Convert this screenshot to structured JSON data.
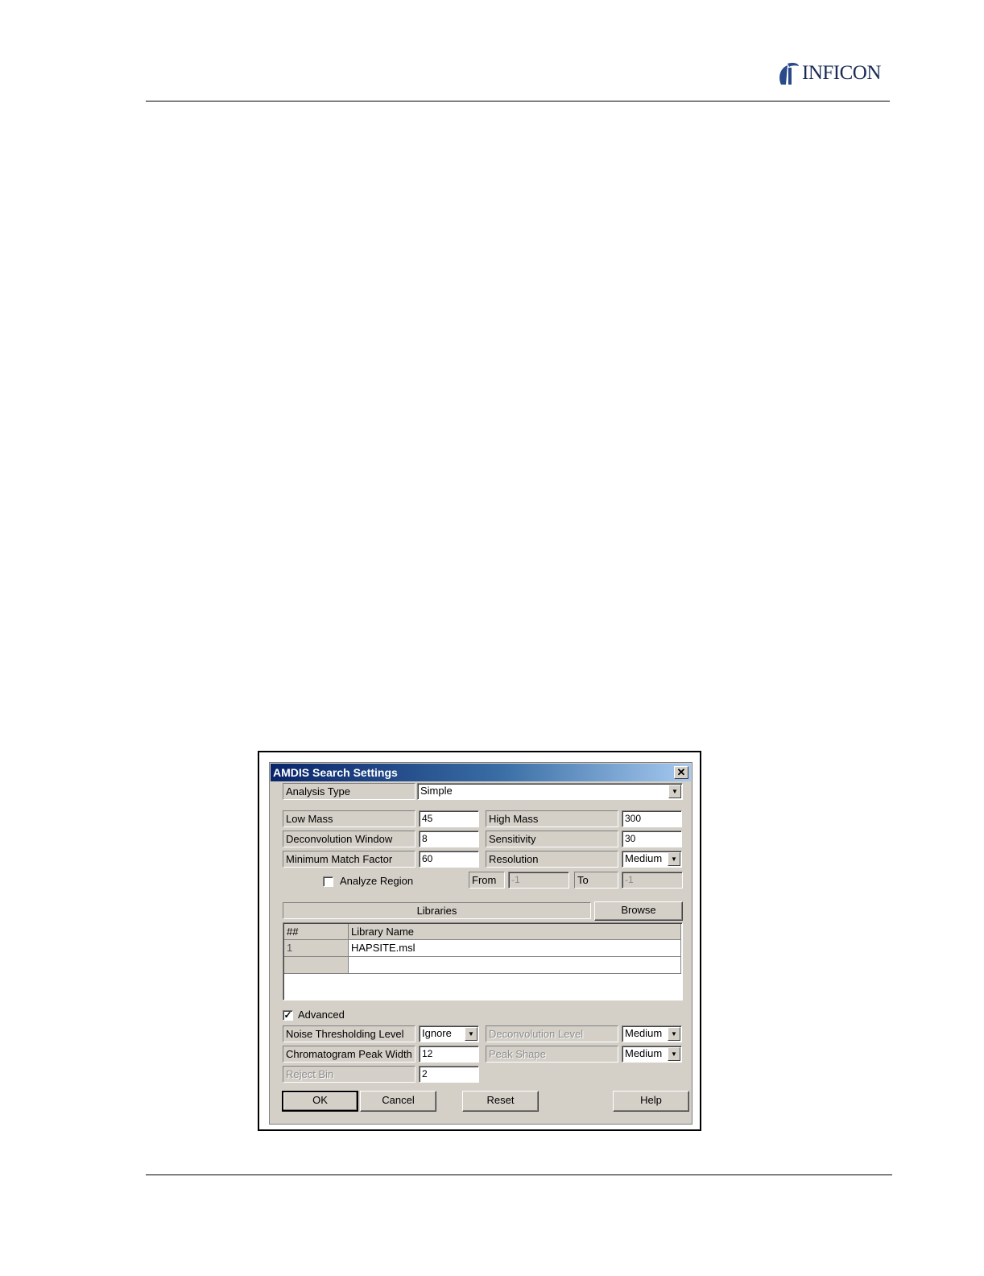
{
  "header": {
    "brand": "INFICON"
  },
  "dialog": {
    "title": "AMDIS Search Settings",
    "close_glyph": "✕",
    "analysis_type": {
      "label": "Analysis Type",
      "value": "Simple"
    },
    "low_mass": {
      "label": "Low Mass",
      "value": "45"
    },
    "high_mass": {
      "label": "High Mass",
      "value": "300"
    },
    "deconvolution_window": {
      "label": "Deconvolution Window",
      "value": "8"
    },
    "sensitivity": {
      "label": "Sensitivity",
      "value": "30"
    },
    "minimum_match_factor": {
      "label": "Minimum Match Factor",
      "value": "60"
    },
    "resolution": {
      "label": "Resolution",
      "value": "Medium"
    },
    "analyze_region": {
      "label": "Analyze Region",
      "checked": false,
      "from_label": "From",
      "from_value": "-1",
      "to_label": "To",
      "to_value": "-1"
    },
    "libraries": {
      "label": "Libraries",
      "browse_label": "Browse",
      "columns": [
        "##",
        "Library Name"
      ],
      "rows": [
        {
          "num": "1",
          "name": "HAPSITE.msl"
        },
        {
          "num": "",
          "name": ""
        }
      ]
    },
    "advanced": {
      "label": "Advanced",
      "checked": true,
      "check_glyph": "✓"
    },
    "noise_thresholding_level": {
      "label": "Noise Thresholding Level",
      "value": "Ignore"
    },
    "deconvolution_level": {
      "label": "Deconvolution Level",
      "value": "Medium"
    },
    "chromatogram_peak_width": {
      "label": "Chromatogram Peak Width",
      "value": "12"
    },
    "peak_shape": {
      "label": "Peak Shape",
      "value": "Medium"
    },
    "reject_bin": {
      "label": "Reject Bin",
      "value": "2"
    },
    "buttons": {
      "ok": "OK",
      "cancel": "Cancel",
      "reset": "Reset",
      "help": "Help"
    },
    "dropdown_arrow": "▼"
  }
}
